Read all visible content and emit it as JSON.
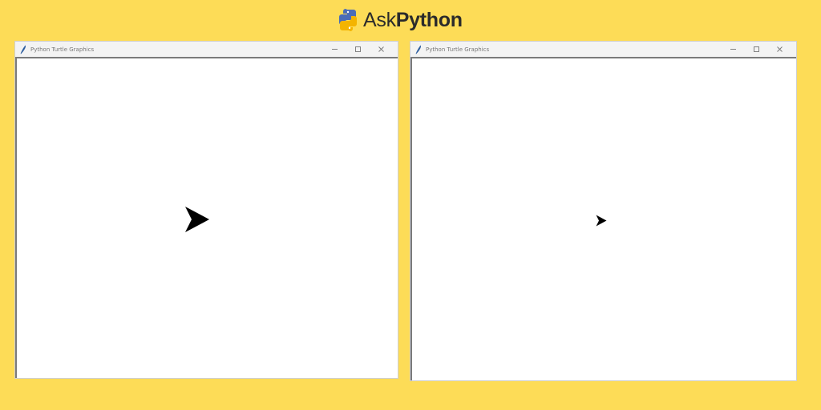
{
  "brand": {
    "name_prefix": "Ask",
    "name_bold": "Python",
    "colors": {
      "blue": "#4B6CB7",
      "yellow": "#F4B400",
      "text": "#2b2b2b"
    },
    "logo_icon": "python-logo-icon"
  },
  "background_color": "#FDDC57",
  "windows": [
    {
      "title": "Python Turtle Graphics",
      "controls": [
        "minimize-icon",
        "maximize-icon",
        "close-icon"
      ],
      "turtle": {
        "shape": "arrow",
        "color": "#000000",
        "heading": "east",
        "size": "large"
      }
    },
    {
      "title": "Python Turtle Graphics",
      "controls": [
        "minimize-icon",
        "maximize-icon",
        "close-icon"
      ],
      "turtle": {
        "shape": "arrow",
        "color": "#000000",
        "heading": "east",
        "size": "small"
      }
    }
  ]
}
